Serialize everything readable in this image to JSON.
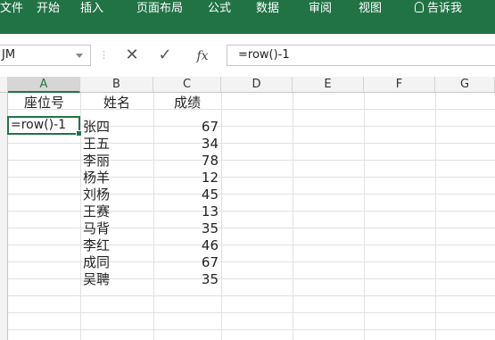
{
  "ribbon": {
    "tabs": [
      "文件",
      "开始",
      "插入",
      "页面布局",
      "公式",
      "数据",
      "审阅",
      "视图"
    ],
    "tell_me": "告诉我"
  },
  "formula_bar": {
    "name_box": "JM",
    "fx_label": "fx",
    "cancel_symbol": "✕",
    "enter_symbol": "✓",
    "formula": "=row()-1"
  },
  "columns": [
    "A",
    "B",
    "C",
    "D",
    "E",
    "F",
    "G"
  ],
  "active_column": "A",
  "table": {
    "headers": [
      "座位号",
      "姓名",
      "成绩"
    ],
    "active_cell_value": "=row()-1",
    "rows": [
      {
        "name": "张四",
        "score": "67"
      },
      {
        "name": "王五",
        "score": "34"
      },
      {
        "name": "李丽",
        "score": "78"
      },
      {
        "name": "杨羊",
        "score": "12"
      },
      {
        "name": "刘杨",
        "score": "45"
      },
      {
        "name": "王赛",
        "score": "13"
      },
      {
        "name": "马背",
        "score": "35"
      },
      {
        "name": "李红",
        "score": "46"
      },
      {
        "name": "成同",
        "score": "67"
      },
      {
        "name": "吴聘",
        "score": "35"
      }
    ]
  },
  "colors": {
    "accent": "#217346"
  }
}
